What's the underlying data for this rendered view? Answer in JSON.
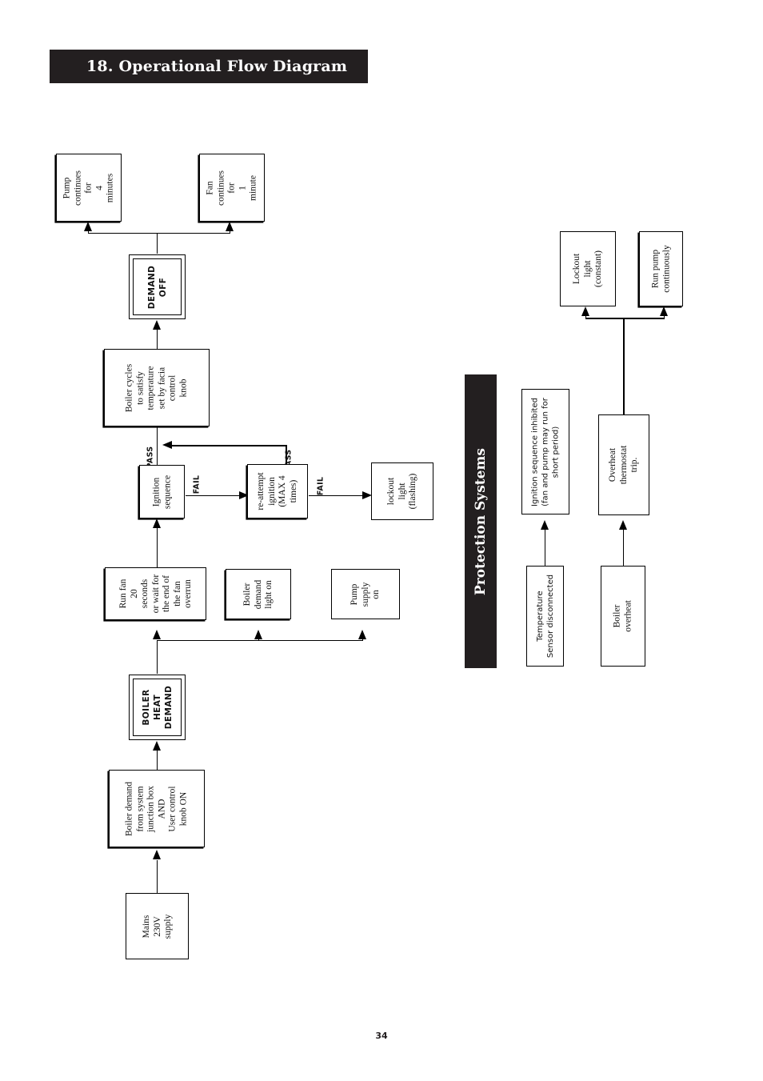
{
  "page": {
    "section_title": "18. Operational Flow Diagram",
    "page_number": "34",
    "colors": {
      "banner_background": "#231f20",
      "banner_text": "#ffffff",
      "line": "#000000",
      "page_background": "#ffffff"
    }
  },
  "protection_banner": {
    "label": "Protection Systems"
  },
  "main_flow": {
    "boxes": {
      "pump_continues": "Pump\ncontinues\nfor\n4\nminutes",
      "fan_continues": "Fan\ncontinues\nfor\n1\nminute",
      "demand_off": "DEMAND\nOFF",
      "boiler_cycles": "Boiler cycles\nto satisfy\ntemperature\nset by facia\ncontrol\nknob",
      "ignition_sequence": "Ignition\nsequence",
      "re_attempt": "re-attempt\nignition\n(MAX 4\ntimes)",
      "lockout_flashing": "lockout\nlight\n(flashing)",
      "run_fan": "Run fan\n20\nseconds\nor wait for\nthe end of\nthe fan\noverrun",
      "boiler_demand_light": "Boiler\ndemand\nlight on",
      "pump_supply": "Pump\nsupply\non",
      "boiler_heat_demand": "BOILER\nHEAT\nDEMAND",
      "boiler_demand_source": "Boiler demand\nfrom system\njunction box\nAND\nUser control\nknob ON",
      "mains_supply": "Mains\n230V\nsupply"
    },
    "edge_labels": {
      "pass_to_cycles": "PASS",
      "fail_to_reattempt": "FAIL",
      "pass_from_reattempt": "PASS",
      "fail_to_lockout": "FAIL"
    }
  },
  "protection_flow": {
    "boxes": {
      "lockout_constant": "Lockout\nlight\n(constant)",
      "run_pump": "Run pump\ncontinuously",
      "ignition_inhibited": "Ignition sequence inhibited\n(fan and pump may run for\nshort period)",
      "overheat_trip": "Overheat\nthermostat\ntrip.",
      "temp_sensor_disconnected": "Temperature\nSensor disconnected",
      "boiler_overheat": "Boiler\noverheat"
    }
  }
}
